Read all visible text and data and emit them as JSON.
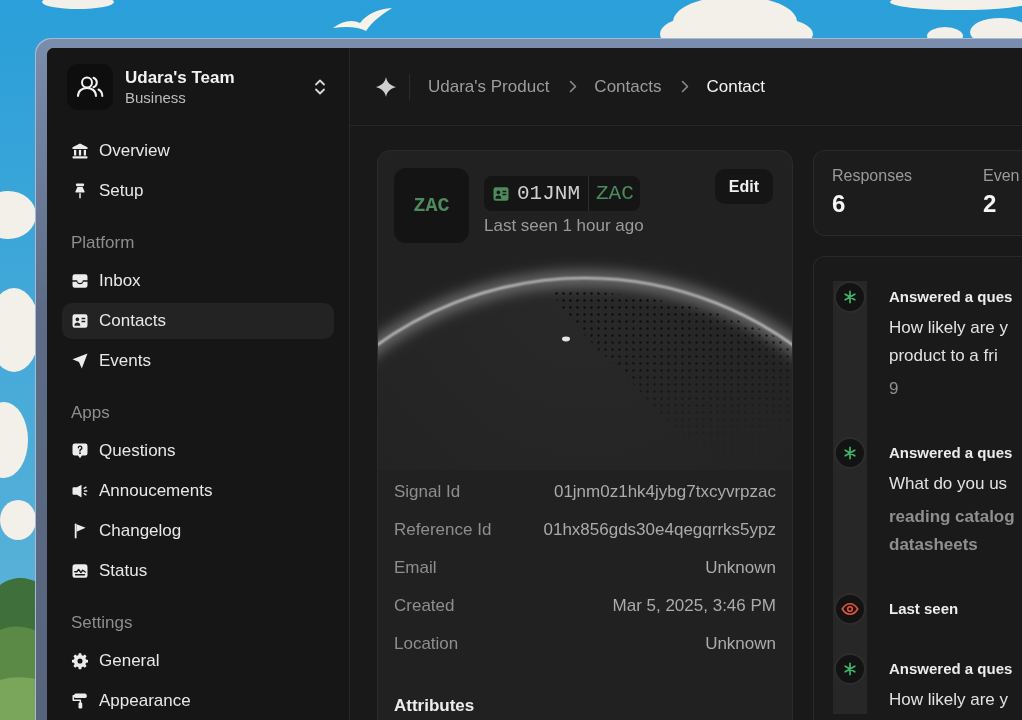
{
  "sidebar": {
    "team": {
      "name": "Udara's Team",
      "plan": "Business"
    },
    "sections": [
      {
        "items": [
          {
            "label": "Overview",
            "selected": false
          },
          {
            "label": "Setup",
            "selected": false
          }
        ]
      },
      {
        "heading": "Platform",
        "items": [
          {
            "label": "Inbox",
            "selected": false
          },
          {
            "label": "Contacts",
            "selected": true
          },
          {
            "label": "Events",
            "selected": false
          }
        ]
      },
      {
        "heading": "Apps",
        "items": [
          {
            "label": "Questions",
            "selected": false
          },
          {
            "label": "Annoucements",
            "selected": false
          },
          {
            "label": "Changelog",
            "selected": false
          },
          {
            "label": "Status",
            "selected": false
          }
        ]
      },
      {
        "heading": "Settings",
        "items": [
          {
            "label": "General",
            "selected": false
          },
          {
            "label": "Appearance",
            "selected": false
          }
        ]
      }
    ]
  },
  "header": {
    "breadcrumb": [
      {
        "label": "Udara's Product",
        "current": false
      },
      {
        "label": "Contacts",
        "current": false
      },
      {
        "label": "Contact",
        "current": true
      }
    ]
  },
  "contact": {
    "initials": "ZAC",
    "id_chip": {
      "id": "01JNM",
      "suffix": "ZAC"
    },
    "last_seen": "Last seen 1 hour ago",
    "edit_button": "Edit",
    "details": [
      {
        "label": "Signal Id",
        "value": "01jnm0z1hk4jybg7txcyvrpzac"
      },
      {
        "label": "Reference Id",
        "value": "01hx856gds30e4qegqrrks5ypz"
      },
      {
        "label": "Email",
        "value": "Unknown"
      },
      {
        "label": "Created",
        "value": "Mar 5, 2025, 3:46 PM"
      },
      {
        "label": "Location",
        "value": "Unknown"
      }
    ],
    "attributes_heading": "Attributes"
  },
  "stats": [
    {
      "label": "Responses",
      "value": "6"
    },
    {
      "label": "Even",
      "value": "2"
    }
  ],
  "timeline": [
    {
      "kind": "rating_answer",
      "title": "Answered a ques",
      "question_lines": [
        "How likely are y",
        "product to a fri"
      ],
      "answer_lines": [
        "9"
      ]
    },
    {
      "kind": "text_answer",
      "title": "Answered a ques",
      "question_lines": [
        "What do you us"
      ],
      "answer_lines": [
        "reading catalog",
        "datasheets"
      ]
    },
    {
      "kind": "last_seen",
      "title": "Last seen"
    },
    {
      "kind": "rating_answer",
      "title": "Answered a ques",
      "question_lines": [
        "How likely are y"
      ]
    }
  ]
}
